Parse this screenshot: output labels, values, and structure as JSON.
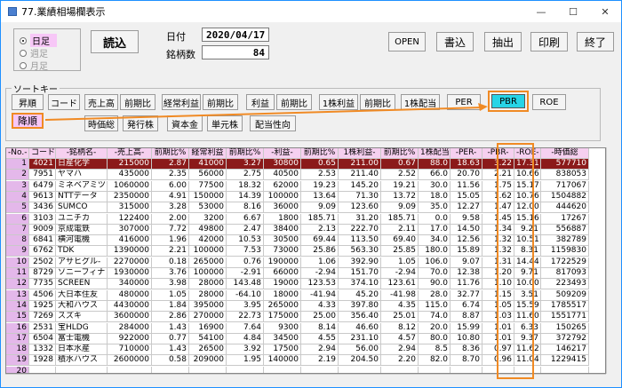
{
  "window": {
    "title": "77.業績相場欄表示",
    "icons": {
      "min": "—",
      "max": "☐",
      "close": "✕"
    }
  },
  "period": {
    "options": [
      {
        "label": "日足",
        "selected": true,
        "enabled": true
      },
      {
        "label": "週足",
        "selected": false,
        "enabled": false
      },
      {
        "label": "月足",
        "selected": false,
        "enabled": false
      }
    ]
  },
  "read_button": "読込",
  "date_label": "日付",
  "date_value": "2020/04/17",
  "count_label": "銘柄数",
  "count_value": "84",
  "top_buttons": [
    "OPEN",
    "書込",
    "抽出",
    "印刷",
    "終了"
  ],
  "sort": {
    "group_label": "ソートキー",
    "asc": "昇順",
    "desc": "降順",
    "row1": [
      "コード",
      "売上高",
      "前期比",
      "経常利益",
      "前期比",
      "利益",
      "前期比",
      "1株利益",
      "前期比",
      "1株配当",
      "PER",
      "PBR",
      "ROE"
    ],
    "row2": [
      "時価総",
      "発行株",
      "資本金",
      "単元株",
      "配当性向"
    ]
  },
  "table": {
    "headers": [
      "-No.-",
      "コード",
      "-銘柄名-",
      "-売上高-",
      "前期比%",
      "経常利益",
      "前期比%",
      "-利益-",
      "前期比%",
      "1株利益-",
      "前期比%",
      "1株配当",
      "-PER-",
      "-PBR-",
      "-ROE-",
      "-時価総"
    ],
    "rows": [
      [
        "1",
        "4021",
        "日産化学",
        "215000",
        "2.87",
        "41000",
        "3.27",
        "30800",
        "0.65",
        "211.00",
        "0.67",
        "88.0",
        "18.63",
        "3.22",
        "17.31",
        "577710"
      ],
      [
        "2",
        "7951",
        "ヤマハ",
        "435000",
        "2.35",
        "56000",
        "2.75",
        "40500",
        "2.53",
        "211.40",
        "2.52",
        "66.0",
        "20.70",
        "2.21",
        "10.66",
        "838053"
      ],
      [
        "3",
        "6479",
        "ミネベアミツ",
        "1060000",
        "6.00",
        "77500",
        "18.32",
        "62000",
        "19.23",
        "145.20",
        "19.21",
        "30.0",
        "11.56",
        "1.75",
        "15.17",
        "717067"
      ],
      [
        "4",
        "9613",
        "NTTデータ",
        "2350000",
        "4.91",
        "150000",
        "14.39",
        "100000",
        "13.64",
        "71.30",
        "13.72",
        "18.0",
        "15.05",
        "1.62",
        "10.76",
        "1504882"
      ],
      [
        "5",
        "3436",
        "SUMCO",
        "315000",
        "3.28",
        "53000",
        "8.16",
        "36000",
        "9.09",
        "123.60",
        "9.09",
        "35.0",
        "12.27",
        "1.47",
        "12.00",
        "444620"
      ],
      [
        "6",
        "3103",
        "ユニチカ",
        "122400",
        "2.00",
        "3200",
        "6.67",
        "1800",
        "185.71",
        "31.20",
        "185.71",
        "0.0",
        "9.58",
        "1.45",
        "15.16",
        "17267"
      ],
      [
        "7",
        "9009",
        "京成電鉄",
        "307000",
        "7.72",
        "49800",
        "2.47",
        "38400",
        "2.13",
        "222.70",
        "2.11",
        "17.0",
        "14.50",
        "1.34",
        "9.21",
        "556887"
      ],
      [
        "8",
        "6841",
        "横河電機",
        "416000",
        "1.96",
        "42000",
        "10.53",
        "30500",
        "69.44",
        "113.50",
        "69.40",
        "34.0",
        "12.56",
        "1.32",
        "10.51",
        "382789"
      ],
      [
        "9",
        "6762",
        "TDK",
        "1390000",
        "2.21",
        "100000",
        "7.53",
        "73000",
        "25.86",
        "563.30",
        "25.85",
        "180.0",
        "15.89",
        "1.32",
        "8.31",
        "1159830"
      ],
      [
        "10",
        "2502",
        "アサヒグル-",
        "2270000",
        "0.18",
        "265000",
        "0.76",
        "190000",
        "1.06",
        "392.90",
        "1.05",
        "106.0",
        "9.07",
        "1.31",
        "14.44",
        "1722529"
      ],
      [
        "11",
        "8729",
        "ソニーフィナ",
        "1930000",
        "3.76",
        "100000",
        "-2.91",
        "66000",
        "-2.94",
        "151.70",
        "-2.94",
        "70.0",
        "12.38",
        "1.20",
        "9.71",
        "817093"
      ],
      [
        "12",
        "7735",
        "SCREEN",
        "340000",
        "3.98",
        "28000",
        "143.48",
        "19000",
        "123.53",
        "374.10",
        "123.61",
        "90.0",
        "11.76",
        "1.10",
        "10.00",
        "223493"
      ],
      [
        "13",
        "4506",
        "大日本住友",
        "480000",
        "1.05",
        "28000",
        "-64.10",
        "18000",
        "-41.94",
        "45.20",
        "-41.98",
        "28.0",
        "32.77",
        "1.15",
        "3.51",
        "509209"
      ],
      [
        "14",
        "1925",
        "大和ハウス",
        "4430000",
        "1.84",
        "395000",
        "3.95",
        "265000",
        "4.33",
        "397.80",
        "4.35",
        "115.0",
        "6.74",
        "1.05",
        "15.59",
        "1785517"
      ],
      [
        "15",
        "7269",
        "スズキ",
        "3600000",
        "2.86",
        "270000",
        "22.73",
        "175000",
        "25.00",
        "356.40",
        "25.01",
        "74.0",
        "8.87",
        "1.03",
        "11.60",
        "1551771"
      ],
      [
        "16",
        "2531",
        "宝HLDG",
        "284000",
        "1.43",
        "16900",
        "7.64",
        "9300",
        "8.14",
        "46.60",
        "8.12",
        "20.0",
        "15.99",
        "1.01",
        "6.33",
        "150265"
      ],
      [
        "17",
        "6504",
        "富士電機",
        "922000",
        "0.77",
        "54100",
        "4.84",
        "34500",
        "4.55",
        "231.10",
        "4.57",
        "80.0",
        "10.80",
        "1.01",
        "9.37",
        "372792"
      ],
      [
        "18",
        "1332",
        "日本水産",
        "710000",
        "1.43",
        "26500",
        "3.92",
        "17500",
        "2.94",
        "56.00",
        "2.94",
        "8.5",
        "8.36",
        "0.97",
        "11.62",
        "146217"
      ],
      [
        "19",
        "1928",
        "積水ハウス",
        "2600000",
        "0.58",
        "209000",
        "1.95",
        "140000",
        "2.19",
        "204.50",
        "2.20",
        "82.0",
        "8.70",
        "0.96",
        "11.04",
        "1229415"
      ],
      [
        "20",
        "",
        "",
        "",
        "",
        "",
        "",
        "",
        "",
        "",
        "",
        "",
        "",
        "",
        "",
        ""
      ]
    ]
  }
}
